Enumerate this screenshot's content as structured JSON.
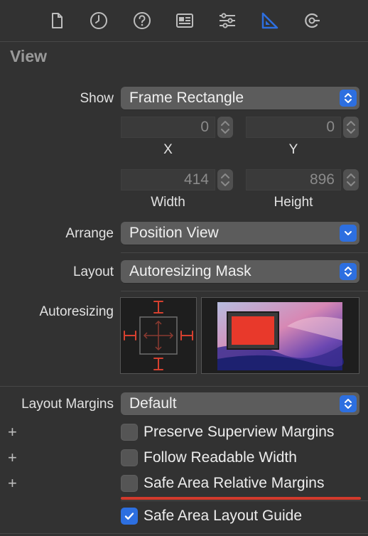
{
  "toolbar": {
    "tabs": [
      {
        "icon": "file-icon"
      },
      {
        "icon": "history-icon"
      },
      {
        "icon": "help-icon"
      },
      {
        "icon": "identity-inspector-icon"
      },
      {
        "icon": "attributes-inspector-icon"
      },
      {
        "icon": "size-inspector-icon",
        "selected": true
      },
      {
        "icon": "connections-inspector-icon"
      }
    ],
    "accent": "#2d6fe0"
  },
  "section": {
    "title": "View"
  },
  "show": {
    "label": "Show",
    "value": "Frame Rectangle"
  },
  "frame": {
    "x": {
      "value": "0",
      "caption": "X"
    },
    "y": {
      "value": "0",
      "caption": "Y"
    },
    "width": {
      "value": "414",
      "caption": "Width"
    },
    "height": {
      "value": "896",
      "caption": "Height"
    }
  },
  "arrange": {
    "label": "Arrange",
    "value": "Position View"
  },
  "layout": {
    "label": "Layout",
    "value": "Autoresizing Mask"
  },
  "autoresizing": {
    "label": "Autoresizing"
  },
  "layout_margins": {
    "label": "Layout Margins",
    "value": "Default"
  },
  "options": [
    {
      "label": "Preserve Superview Margins",
      "checked": false
    },
    {
      "label": "Follow Readable Width",
      "checked": false
    },
    {
      "label": "Safe Area Relative Margins",
      "checked": false
    },
    {
      "label": "Safe Area Layout Guide",
      "checked": true
    }
  ],
  "colors": {
    "strut": "#d6402f",
    "highlight": "#d23a2c"
  }
}
